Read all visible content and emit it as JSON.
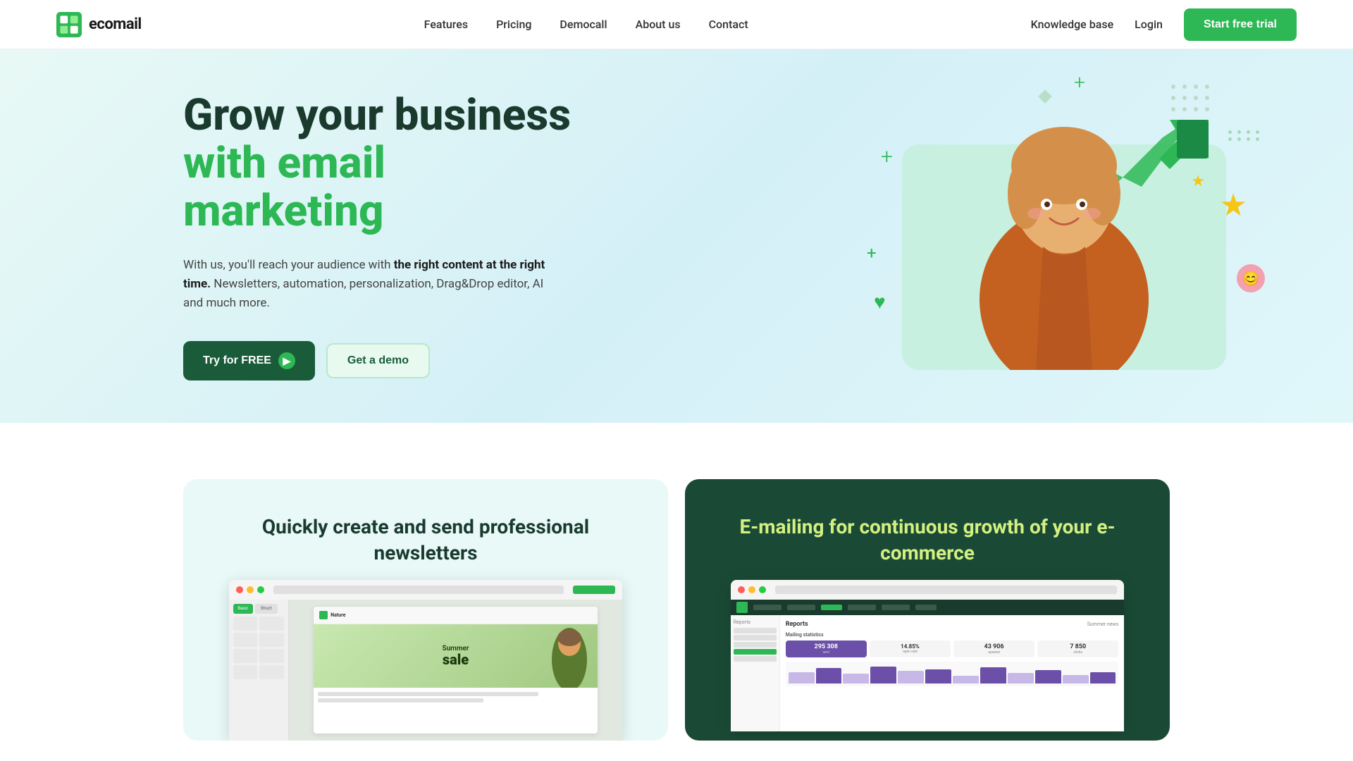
{
  "navbar": {
    "logo_text": "ecomail",
    "nav_items": [
      {
        "label": "Features",
        "id": "features"
      },
      {
        "label": "Pricing",
        "id": "pricing"
      },
      {
        "label": "Democall",
        "id": "democall"
      },
      {
        "label": "About us",
        "id": "about"
      },
      {
        "label": "Contact",
        "id": "contact"
      }
    ],
    "knowledge_base": "Knowledge base",
    "login": "Login",
    "start_trial": "Start free trial"
  },
  "hero": {
    "title_line1": "Grow your business",
    "title_line2": "with email marketing",
    "description_normal": "With us, you'll reach your audience with ",
    "description_bold": "the right content at the right time.",
    "description_rest": " Newsletters, automation, personalization, Drag&Drop editor, AI and much more.",
    "btn_try_free": "Try for FREE",
    "btn_get_demo": "Get a demo"
  },
  "cards": {
    "card1_title": "Quickly create and send professional newsletters",
    "card2_title": "E-mailing for continuous growth of your e-commerce",
    "card2_title_highlight": "E-mailing for continuous growth of your e-commerce"
  },
  "mock_data": {
    "summer_sale": "Summer sale",
    "reports_title": "Reports",
    "mailing_stats": "Mailing statistics",
    "stat1": "295 308",
    "stat2": "43 906",
    "stat3": "7 850",
    "summer_news": "Summer news"
  },
  "colors": {
    "green_primary": "#2db855",
    "green_dark": "#1a4a36",
    "hero_bg": "#e4f7f2"
  }
}
